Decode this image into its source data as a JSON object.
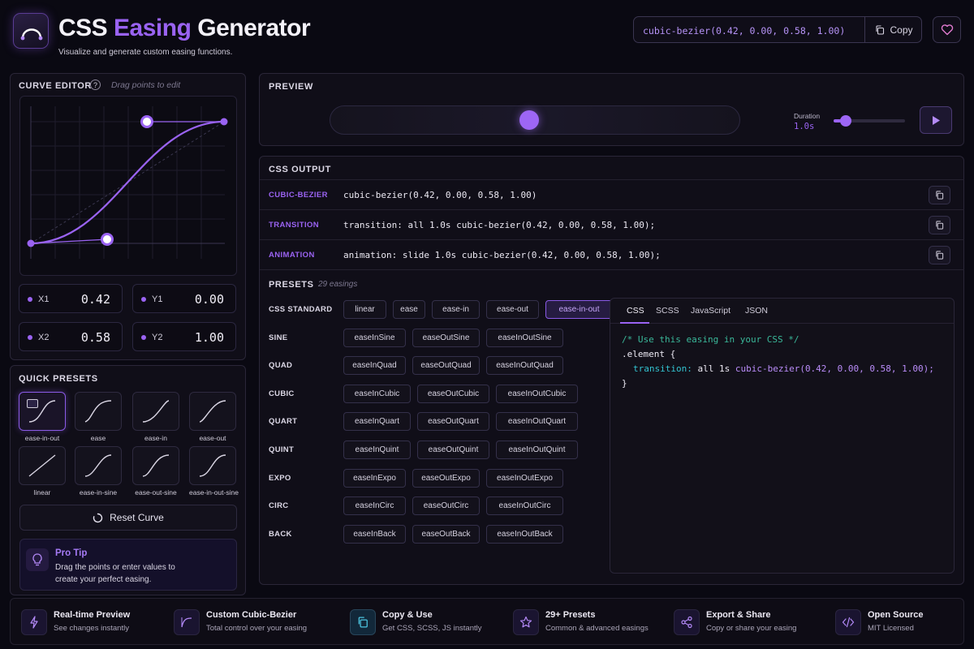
{
  "header": {
    "title_main": "CSS ",
    "title_accent": "Easing",
    "title_rest": " Generator",
    "subtitle": "Visualize and generate custom easing functions.",
    "output_value": "cubic-bezier(0.42, 0.00, 0.58, 1.00)",
    "copy_label": "Copy"
  },
  "curve_editor": {
    "title": "Curve Editor",
    "hint": "Drag points to edit",
    "params": [
      {
        "label": "X1",
        "value": "0.42"
      },
      {
        "label": "Y1",
        "value": "0.00"
      },
      {
        "label": "X2",
        "value": "0.58"
      },
      {
        "label": "Y2",
        "value": "1.00"
      }
    ]
  },
  "quick_presets": {
    "title": "Quick Presets",
    "items": [
      "ease-in-out",
      "ease",
      "ease-in",
      "ease-out",
      "linear",
      "ease-in-sine",
      "ease-out-sine",
      "ease-in-out-sine"
    ],
    "active": "ease-in-out",
    "reset_label": "Reset Curve",
    "tip_title": "Pro Tip",
    "tip_text": "Drag the points or enter values to create your perfect easing."
  },
  "preview": {
    "title": "Preview",
    "duration_label": "Duration",
    "duration_value": "1.0s",
    "duration_fraction": 0.1
  },
  "css_output": {
    "title": "CSS Output",
    "rows": [
      {
        "key": "CUBIC-BEZIER",
        "value": "cubic-bezier(0.42, 0.00, 0.58, 1.00)"
      },
      {
        "key": "TRANSITION",
        "value": "transition: all 1.0s cubic-bezier(0.42, 0.00, 0.58, 1.00);"
      },
      {
        "key": "ANIMATION",
        "value": "animation: slide 1.0s cubic-bezier(0.42, 0.00, 0.58, 1.00);"
      }
    ]
  },
  "presets": {
    "title": "Presets",
    "count": "29 easings",
    "groups": [
      {
        "name": "CSS STANDARD",
        "items": [
          "linear",
          "ease",
          "ease-in",
          "ease-out",
          "ease-in-out"
        ]
      },
      {
        "name": "SINE",
        "items": [
          "easeInSine",
          "easeOutSine",
          "easeInOutSine"
        ]
      },
      {
        "name": "QUAD",
        "items": [
          "easeInQuad",
          "easeOutQuad",
          "easeInOutQuad"
        ]
      },
      {
        "name": "CUBIC",
        "items": [
          "easeInCubic",
          "easeOutCubic",
          "easeInOutCubic"
        ]
      },
      {
        "name": "QUART",
        "items": [
          "easeInQuart",
          "easeOutQuart",
          "easeInOutQuart"
        ]
      },
      {
        "name": "QUINT",
        "items": [
          "easeInQuint",
          "easeOutQuint",
          "easeInOutQuint"
        ]
      },
      {
        "name": "EXPO",
        "items": [
          "easeInExpo",
          "easeOutExpo",
          "easeInOutExpo"
        ]
      },
      {
        "name": "CIRC",
        "items": [
          "easeInCirc",
          "easeOutCirc",
          "easeInOutCirc"
        ]
      },
      {
        "name": "BACK",
        "items": [
          "easeInBack",
          "easeOutBack",
          "easeInOutBack"
        ]
      }
    ],
    "active": "ease-in-out"
  },
  "code": {
    "tabs": [
      "CSS",
      "SCSS",
      "JavaScript",
      "JSON"
    ],
    "active_tab": "CSS",
    "comment": "/* Use this easing in your CSS */",
    "selector": ".element {",
    "prop": "transition:",
    "prop_value_pre": " all 1s ",
    "prop_value_fn": "cubic-bezier(",
    "prop_value_args": "0.42, 0.00, 0.58, 1.00",
    "prop_value_post": ");",
    "close": "}"
  },
  "footer": {
    "features": [
      {
        "icon": "bolt-icon",
        "title": "Real-time Preview",
        "desc": "See changes instantly"
      },
      {
        "icon": "curve-icon",
        "title": "Custom Cubic-Bezier",
        "desc": "Total control over your easing"
      },
      {
        "icon": "copy-icon",
        "title": "Copy & Use",
        "desc": "Get CSS, SCSS, JS instantly"
      },
      {
        "icon": "star-icon",
        "title": "29+ Presets",
        "desc": "Common & advanced easings"
      },
      {
        "icon": "share-icon",
        "title": "Export & Share",
        "desc": "Copy or share your easing"
      },
      {
        "icon": "code-icon",
        "title": "Open Source",
        "desc": "MIT Licensed"
      }
    ]
  },
  "colors": {
    "accent": "#9a63f2",
    "background": "#0a0912",
    "panel": "#100e18"
  }
}
